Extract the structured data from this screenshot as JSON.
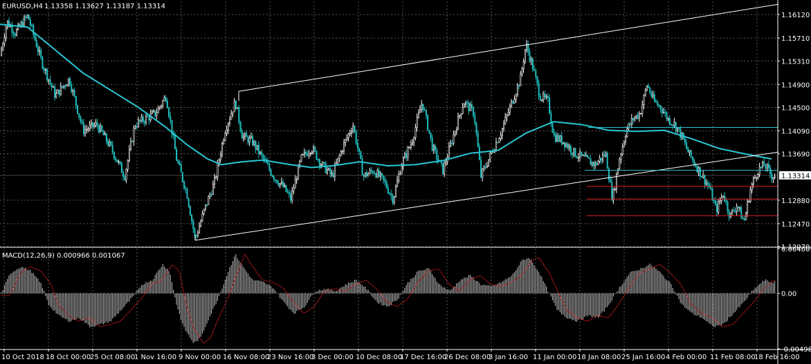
{
  "header": {
    "symbol": "EURUSD,H4",
    "ohlc": "1.13358 1.13627 1.13187 1.13314"
  },
  "macd_header": {
    "label": "MACD(12,26,9) 0.000966 0.001067"
  },
  "colors": {
    "background": "#000000",
    "bull_candle": "#ffffff",
    "bear_candle": "#1fbfbf",
    "moving_average": "#2ac7d6",
    "trendline": "#ffffff",
    "support_lines": "#e02020",
    "resistance_lines": "#2ac7d6",
    "macd_histogram": "#c8c8c8",
    "macd_signal": "#e02020",
    "grid": "#5a5a5a"
  },
  "chart_data": [
    {
      "type": "candlestick",
      "title": "EURUSD,H4",
      "ylim": [
        1.1207,
        1.1635
      ],
      "y_ticks": [
        "1.16120",
        "1.15710",
        "1.15310",
        "1.14900",
        "1.14500",
        "1.14090",
        "1.13690",
        "1.13314",
        "1.12880",
        "1.12470",
        "1.12070"
      ],
      "current_price": "1.13314",
      "x_ticks": [
        "10 Oct 2018",
        "18 Oct 00:00",
        "25 Oct 08:00",
        "1 Nov 16:00",
        "9 Nov 00:00",
        "16 Nov 08:00",
        "23 Nov 16:00",
        "3 Dec 00:00",
        "10 Dec 08:00",
        "17 Dec 16:00",
        "26 Dec 08:00",
        "3 Jan 16:00",
        "11 Jan 00:00",
        "18 Jan 08:00",
        "25 Jan 16:00",
        "4 Feb 00:00",
        "11 Feb 08:00",
        "18 Feb 16:00"
      ],
      "grid": true,
      "path": [
        [
          0,
          1.154
        ],
        [
          10,
          1.16
        ],
        [
          22,
          1.158
        ],
        [
          40,
          1.161
        ],
        [
          60,
          1.153
        ],
        [
          80,
          1.147
        ],
        [
          100,
          1.15
        ],
        [
          120,
          1.141
        ],
        [
          140,
          1.142
        ],
        [
          160,
          1.138
        ],
        [
          180,
          1.133
        ],
        [
          195,
          1.142
        ],
        [
          210,
          1.143
        ],
        [
          225,
          1.144
        ],
        [
          240,
          1.147
        ],
        [
          255,
          1.136
        ],
        [
          270,
          1.13
        ],
        [
          282,
          1.122
        ],
        [
          295,
          1.127
        ],
        [
          310,
          1.132
        ],
        [
          325,
          1.141
        ],
        [
          340,
          1.146
        ],
        [
          350,
          1.14
        ],
        [
          365,
          1.139
        ],
        [
          380,
          1.136
        ],
        [
          395,
          1.133
        ],
        [
          410,
          1.131
        ],
        [
          420,
          1.129
        ],
        [
          435,
          1.136
        ],
        [
          450,
          1.138
        ],
        [
          465,
          1.135
        ],
        [
          480,
          1.133
        ],
        [
          495,
          1.138
        ],
        [
          510,
          1.142
        ],
        [
          525,
          1.133
        ],
        [
          540,
          1.134
        ],
        [
          555,
          1.132
        ],
        [
          568,
          1.129
        ],
        [
          580,
          1.135
        ],
        [
          595,
          1.139
        ],
        [
          610,
          1.146
        ],
        [
          625,
          1.138
        ],
        [
          640,
          1.134
        ],
        [
          655,
          1.14
        ],
        [
          670,
          1.146
        ],
        [
          685,
          1.144
        ],
        [
          695,
          1.133
        ],
        [
          710,
          1.137
        ],
        [
          725,
          1.141
        ],
        [
          740,
          1.146
        ],
        [
          752,
          1.15
        ],
        [
          760,
          1.156
        ],
        [
          770,
          1.152
        ],
        [
          780,
          1.147
        ],
        [
          792,
          1.146
        ],
        [
          800,
          1.14
        ],
        [
          815,
          1.139
        ],
        [
          830,
          1.137
        ],
        [
          845,
          1.136
        ],
        [
          860,
          1.135
        ],
        [
          875,
          1.137
        ],
        [
          885,
          1.129
        ],
        [
          895,
          1.136
        ],
        [
          905,
          1.141
        ],
        [
          915,
          1.143
        ],
        [
          925,
          1.144
        ],
        [
          935,
          1.149
        ],
        [
          945,
          1.146
        ],
        [
          955,
          1.145
        ],
        [
          965,
          1.143
        ],
        [
          975,
          1.142
        ],
        [
          985,
          1.14
        ],
        [
          995,
          1.137
        ],
        [
          1005,
          1.135
        ],
        [
          1015,
          1.133
        ],
        [
          1025,
          1.131
        ],
        [
          1035,
          1.127
        ],
        [
          1045,
          1.13
        ],
        [
          1055,
          1.126
        ],
        [
          1065,
          1.128
        ],
        [
          1075,
          1.125
        ],
        [
          1085,
          1.131
        ],
        [
          1095,
          1.134
        ],
        [
          1105,
          1.135
        ],
        [
          1115,
          1.1331
        ]
      ],
      "moving_average": [
        [
          0,
          1.1595
        ],
        [
          40,
          1.159
        ],
        [
          80,
          1.155
        ],
        [
          120,
          1.151
        ],
        [
          160,
          1.148
        ],
        [
          200,
          1.145
        ],
        [
          240,
          1.1415
        ],
        [
          270,
          1.1385
        ],
        [
          300,
          1.136
        ],
        [
          320,
          1.135
        ],
        [
          350,
          1.1355
        ],
        [
          380,
          1.1358
        ],
        [
          420,
          1.135
        ],
        [
          450,
          1.1345
        ],
        [
          480,
          1.1348
        ],
        [
          520,
          1.1355
        ],
        [
          560,
          1.1348
        ],
        [
          600,
          1.135
        ],
        [
          640,
          1.1357
        ],
        [
          680,
          1.137
        ],
        [
          720,
          1.1375
        ],
        [
          760,
          1.1405
        ],
        [
          800,
          1.1425
        ],
        [
          840,
          1.142
        ],
        [
          880,
          1.141
        ],
        [
          920,
          1.1408
        ],
        [
          960,
          1.141
        ],
        [
          1000,
          1.1395
        ],
        [
          1040,
          1.1378
        ],
        [
          1080,
          1.1368
        ],
        [
          1115,
          1.136
        ]
      ],
      "trendline_upper": [
        [
          345,
          1.1478
        ],
        [
          1125,
          1.163
        ]
      ],
      "trendline_lower": [
        [
          282,
          1.1218
        ],
        [
          1125,
          1.1372
        ]
      ],
      "trendline_upper_start": [
        [
          345,
          1.1478
        ],
        [
          345,
          1.147
        ]
      ],
      "trendline_lower_start": [
        [
          282,
          1.1218
        ],
        [
          282,
          1.1218
        ]
      ],
      "horizontal_levels": [
        {
          "price": 1.1415,
          "x_start": 850,
          "color_key": "resistance_lines"
        },
        {
          "price": 1.134,
          "x_start": 845,
          "color_key": "resistance_lines"
        },
        {
          "price": 1.1312,
          "x_start": 848,
          "color_key": "support_lines"
        },
        {
          "price": 1.129,
          "x_start": 848,
          "color_key": "support_lines"
        },
        {
          "price": 1.1261,
          "x_start": 848,
          "color_key": "support_lines"
        }
      ]
    },
    {
      "type": "histogram",
      "title": "MACD(12,26,9) 0.000966 0.001067",
      "ylim": [
        -0.00498,
        0.004009
      ],
      "y_ticks": [
        "0.004009",
        "0.00",
        "-0.00498"
      ],
      "macd_path": [
        [
          0,
          -0.0002
        ],
        [
          15,
          0.0018
        ],
        [
          30,
          0.0024
        ],
        [
          45,
          0.002
        ],
        [
          60,
          0.0008
        ],
        [
          70,
          -0.001
        ],
        [
          85,
          -0.002
        ],
        [
          100,
          -0.0025
        ],
        [
          115,
          -0.0022
        ],
        [
          130,
          -0.003
        ],
        [
          145,
          -0.0028
        ],
        [
          160,
          -0.0025
        ],
        [
          175,
          -0.0015
        ],
        [
          190,
          -0.0005
        ],
        [
          205,
          0.0008
        ],
        [
          220,
          0.0012
        ],
        [
          235,
          0.0026
        ],
        [
          245,
          0.002
        ],
        [
          255,
          -0.001
        ],
        [
          265,
          -0.003
        ],
        [
          280,
          -0.0045
        ],
        [
          290,
          -0.004
        ],
        [
          300,
          -0.0025
        ],
        [
          315,
          -0.0005
        ],
        [
          330,
          0.002
        ],
        [
          340,
          0.0035
        ],
        [
          350,
          0.0025
        ],
        [
          365,
          0.0012
        ],
        [
          380,
          0.001
        ],
        [
          395,
          0.0005
        ],
        [
          410,
          -0.0008
        ],
        [
          425,
          -0.0018
        ],
        [
          440,
          -0.0012
        ],
        [
          455,
          0.0002
        ],
        [
          470,
          0.0004
        ],
        [
          485,
          0.0002
        ],
        [
          500,
          0.0008
        ],
        [
          515,
          0.0012
        ],
        [
          530,
          0.0004
        ],
        [
          545,
          -0.0008
        ],
        [
          560,
          -0.0012
        ],
        [
          575,
          -0.0005
        ],
        [
          590,
          0.001
        ],
        [
          605,
          0.002
        ],
        [
          620,
          0.0022
        ],
        [
          635,
          0.0008
        ],
        [
          650,
          0.0002
        ],
        [
          665,
          0.0012
        ],
        [
          680,
          0.0016
        ],
        [
          695,
          0.0008
        ],
        [
          710,
          0.0006
        ],
        [
          725,
          0.001
        ],
        [
          740,
          0.0016
        ],
        [
          755,
          0.003
        ],
        [
          765,
          0.0032
        ],
        [
          780,
          0.0018
        ],
        [
          792,
          0.0002
        ],
        [
          805,
          -0.0015
        ],
        [
          820,
          -0.0022
        ],
        [
          835,
          -0.0025
        ],
        [
          850,
          -0.002
        ],
        [
          865,
          -0.0022
        ],
        [
          880,
          -0.001
        ],
        [
          895,
          0.0005
        ],
        [
          910,
          0.0018
        ],
        [
          925,
          0.0022
        ],
        [
          940,
          0.0026
        ],
        [
          955,
          0.0018
        ],
        [
          970,
          0.0008
        ],
        [
          985,
          -0.001
        ],
        [
          1000,
          -0.0018
        ],
        [
          1015,
          -0.0022
        ],
        [
          1030,
          -0.003
        ],
        [
          1045,
          -0.0028
        ],
        [
          1060,
          -0.0018
        ],
        [
          1075,
          -0.0008
        ],
        [
          1090,
          0.0004
        ],
        [
          1105,
          0.0012
        ],
        [
          1115,
          0.001
        ]
      ]
    }
  ]
}
